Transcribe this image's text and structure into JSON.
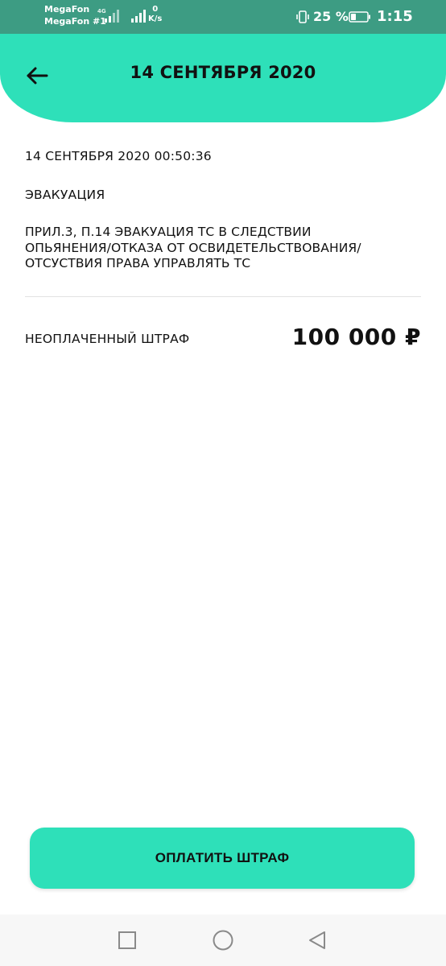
{
  "status_bar": {
    "carrier_1": "MegaFon",
    "carrier_2": "MegaFon #1",
    "network_type": "4G",
    "speed_value": "0",
    "speed_unit": "K/s",
    "battery_percent": "25 %",
    "time": "1:15"
  },
  "header": {
    "title": "14 СЕНТЯБРЯ 2020",
    "back_icon": "arrow-left-icon"
  },
  "fine": {
    "datetime": "14 СЕНТЯБРЯ 2020 00:50:36",
    "category": "ЭВАКУАЦИЯ",
    "description": "ПРИЛ.3, П.14 ЭВАКУАЦИЯ ТС В СЛЕДСТВИИ\nОПЬЯНЕНИЯ/ОТКАЗА ОТ ОСВИДЕТЕЛЬСТВОВАНИЯ/\nОТСУСТВИЯ ПРАВА УПРАВЛЯТЬ ТС",
    "status_label": "НЕОПЛАЧЕННЫЙ ШТРАФ",
    "amount": "100 000 ₽"
  },
  "actions": {
    "pay_label": "ОПЛАТИТЬ ШТРАФ"
  },
  "nav": {
    "recents_icon": "square-icon",
    "home_icon": "circle-icon",
    "back_icon": "triangle-back-icon"
  },
  "colors": {
    "accent": "#2ee0b9",
    "status_bar": "#3d9c83",
    "text": "#111111"
  }
}
